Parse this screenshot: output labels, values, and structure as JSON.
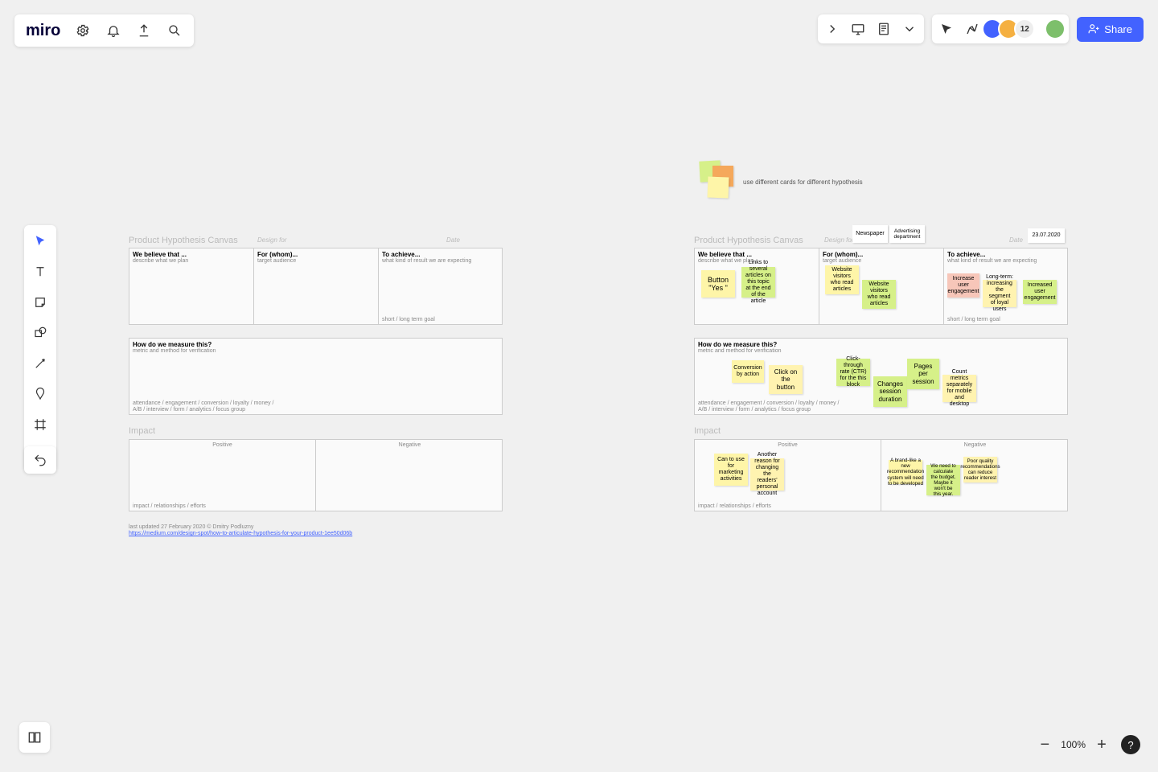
{
  "app": {
    "logo": "miro",
    "share": "Share"
  },
  "zoom": {
    "level": "100%"
  },
  "legend": {
    "hint": "use different cards for different hypothesis"
  },
  "avatars": {
    "count": "12"
  },
  "left": {
    "title": "Product Hypothesis Canvas",
    "design_for_lbl": "Design for",
    "date_lbl": "Date",
    "r1": {
      "believe_h": "We believe that ...",
      "believe_s": "describe what we plan",
      "for_h": "For (whom)...",
      "for_s": "target audience",
      "ach_h": "To achieve...",
      "ach_s": "what kind of result we are expecting",
      "foot": "short / long term goal"
    },
    "r2": {
      "h": "How do we measure this?",
      "s": "metric and method for verification",
      "line1": "attendance / engagement / conversion / loyalty / money /",
      "line2": "A/B / interview / form / analytics / focus group"
    },
    "impact": "Impact",
    "pos": "Positive",
    "neg": "Negative",
    "poslbl": "impact / relationships / efforts",
    "updated": "last updated 27 February 2020 © Dmitry Podluzny",
    "link": "https://medium.com/design-spot/how-to-articulate-hypothesis-for-your-product-1ee50d06b"
  },
  "right": {
    "title": "Product Hypothesis Canvas",
    "design_for_lbl": "Design for",
    "design_for": "Newspaper",
    "design_for2": "Advertising department",
    "date_lbl": "Date",
    "date": "23.07.2020",
    "r1": {
      "believe_h": "We believe that ...",
      "believe_s": "describe what we plan",
      "for_h": "For (whom)...",
      "for_s": "target audience",
      "ach_h": "To achieve...",
      "ach_s": "what kind of result we are expecting",
      "foot": "short / long term goal"
    },
    "notes_r1": {
      "a": "Button \"Yes \"",
      "b": "Links to several articles on this topic at the end of the article",
      "c": "Website visitors who read articles",
      "d": "Website visitors who read articles",
      "e": "Increase user engagement",
      "f": "Long-term: increasing the segment of loyal users",
      "g": "Increased user engagement"
    },
    "r2": {
      "h": "How do we measure this?",
      "s": "metric and method for verification",
      "line1": "attendance / engagement / conversion / loyalty / money /",
      "line2": "A/B / interview / form / analytics / focus group"
    },
    "notes_r2": {
      "a": "Conversion by action",
      "b": "Click on the button",
      "c": "Click-through rate (CTR) for the this block",
      "d": "Changes session duration",
      "e": "Pages per session",
      "f": "Count metrics separately for mobile and desktop"
    },
    "impact": "Impact",
    "pos": "Positive",
    "neg": "Negative",
    "poslbl": "impact / relationships / efforts",
    "notes_pos": {
      "a": "Can to use for marketing activities",
      "b": "Another reason for changing the readers' personal account"
    },
    "notes_neg": {
      "a": "A brand-like a new recommendation system will need to be developed",
      "b": "We need to calculate the budget. Maybe it won't be this year.",
      "c": "Poor quality recommendations can reduce reader interest"
    }
  }
}
